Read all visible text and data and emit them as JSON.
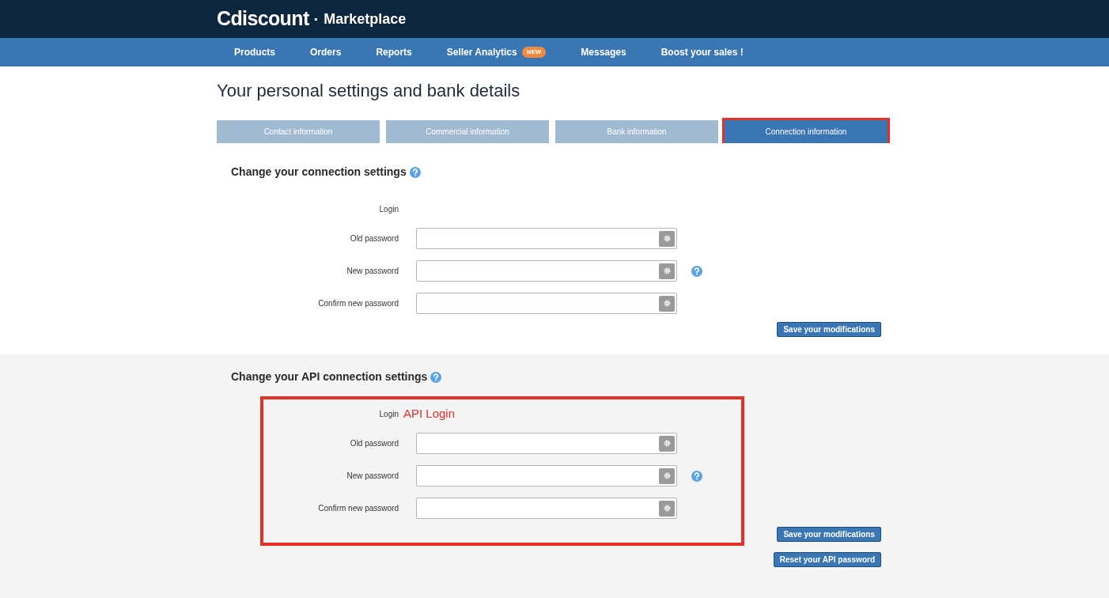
{
  "header": {
    "brand": "Cdiscount",
    "separator": "·",
    "product": "Marketplace"
  },
  "nav": [
    {
      "label": "Products"
    },
    {
      "label": "Orders"
    },
    {
      "label": "Reports"
    },
    {
      "label": "Seller Analytics",
      "badge": "NEW"
    },
    {
      "label": "Messages"
    },
    {
      "label": "Boost your sales !"
    }
  ],
  "page_title": "Your personal settings and bank details",
  "tabs": [
    {
      "label": "Contact information",
      "selected": false,
      "highlighted": false
    },
    {
      "label": "Commercial information",
      "selected": false,
      "highlighted": false
    },
    {
      "label": "Bank information",
      "selected": false,
      "highlighted": false
    },
    {
      "label": "Connection information",
      "selected": true,
      "highlighted": true
    }
  ],
  "sections": [
    {
      "title": "Change your connection settings",
      "shaded": false,
      "highlighted": false,
      "fields": [
        {
          "kind": "text",
          "label": "Login",
          "help": false
        },
        {
          "kind": "password",
          "label": "Old password",
          "help": false
        },
        {
          "kind": "password",
          "label": "New password",
          "help": true
        },
        {
          "kind": "password",
          "label": "Confirm new password",
          "help": false
        }
      ],
      "buttons": [
        "Save your modifications"
      ]
    },
    {
      "title": "Change your API connection settings",
      "shaded": true,
      "highlighted": true,
      "fields": [
        {
          "kind": "text",
          "label": "Login",
          "value": "API Login",
          "help": false
        },
        {
          "kind": "password",
          "label": "Old password",
          "help": false
        },
        {
          "kind": "password",
          "label": "New password",
          "help": true
        },
        {
          "kind": "password",
          "label": "Confirm new password",
          "help": false
        }
      ],
      "buttons": [
        "Save your modifications",
        "Reset your API password"
      ]
    }
  ]
}
